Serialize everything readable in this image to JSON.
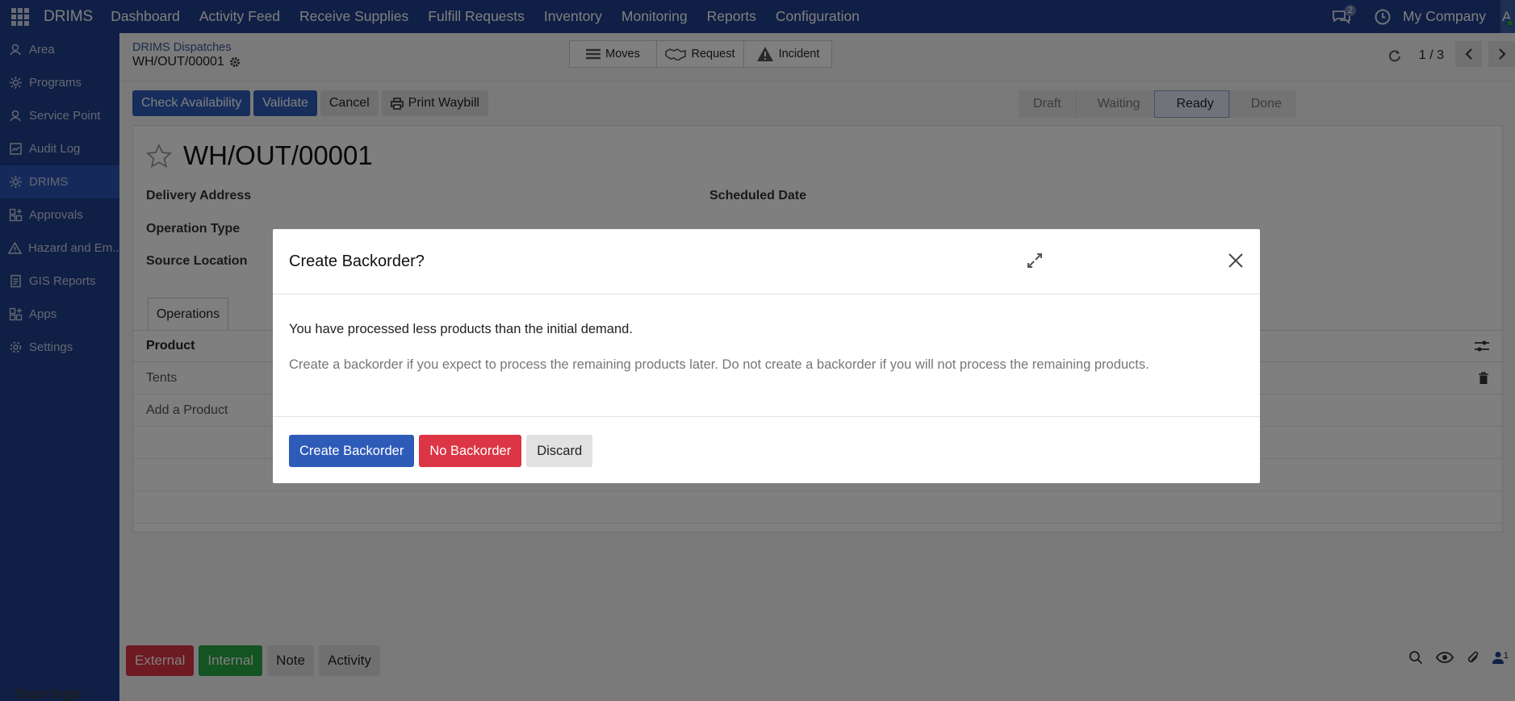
{
  "topbar": {
    "brand": "DRIMS",
    "nav": [
      "Dashboard",
      "Activity Feed",
      "Receive Supplies",
      "Fulfill Requests",
      "Inventory",
      "Monitoring",
      "Reports",
      "Configuration"
    ],
    "chat_count": "2",
    "company": "My Company",
    "avatar_letter": "A"
  },
  "sidebar": {
    "items": [
      {
        "label": "Area",
        "icon": "area-icon"
      },
      {
        "label": "Programs",
        "icon": "programs-icon"
      },
      {
        "label": "Service Point",
        "icon": "service-point-icon"
      },
      {
        "label": "Audit Log",
        "icon": "audit-log-icon"
      },
      {
        "label": "DRIMS",
        "icon": "drims-icon",
        "active": true
      },
      {
        "label": "Approvals",
        "icon": "approvals-icon"
      },
      {
        "label": "Hazard and Em...",
        "icon": "hazard-icon"
      },
      {
        "label": "GIS Reports",
        "icon": "gis-reports-icon"
      },
      {
        "label": "Apps",
        "icon": "apps-icon"
      },
      {
        "label": "Settings",
        "icon": "gear-icon"
      }
    ],
    "logo": "Your logo"
  },
  "control_panel": {
    "breadcrumb_parent": "DRIMS Dispatches",
    "breadcrumb_current": "WH/OUT/00001",
    "smart_buttons": [
      "Moves",
      "Request",
      "Incident"
    ],
    "pager": "1 / 3"
  },
  "actions": {
    "check_availability": "Check Availability",
    "validate": "Validate",
    "cancel": "Cancel",
    "print_waybill": "Print Waybill"
  },
  "status": {
    "steps": [
      "Draft",
      "Waiting",
      "Ready",
      "Done"
    ],
    "current": "Ready"
  },
  "form": {
    "title": "WH/OUT/00001",
    "delivery_address_label": "Delivery Address",
    "operation_type_label": "Operation Type",
    "source_location_label": "Source Location",
    "scheduled_date_label": "Scheduled Date",
    "tab_operations": "Operations",
    "column_product": "Product",
    "rows": [
      "Tents"
    ],
    "add_product": "Add a Product"
  },
  "chatter": {
    "external": "External",
    "internal": "Internal",
    "note": "Note",
    "activity": "Activity",
    "followers": "1"
  },
  "dialog": {
    "title": "Create Backorder?",
    "message": "You have processed less products than the initial demand.",
    "hint": "Create a backorder if you expect to process the remaining products later. Do not create a backorder if you will not process the remaining products.",
    "create_backorder": "Create Backorder",
    "no_backorder": "No Backorder",
    "discard": "Discard"
  },
  "colors": {
    "nav_bg": "#1f3f8a",
    "primary": "#2f5bb8",
    "danger": "#dc3545",
    "success": "#28a745"
  }
}
